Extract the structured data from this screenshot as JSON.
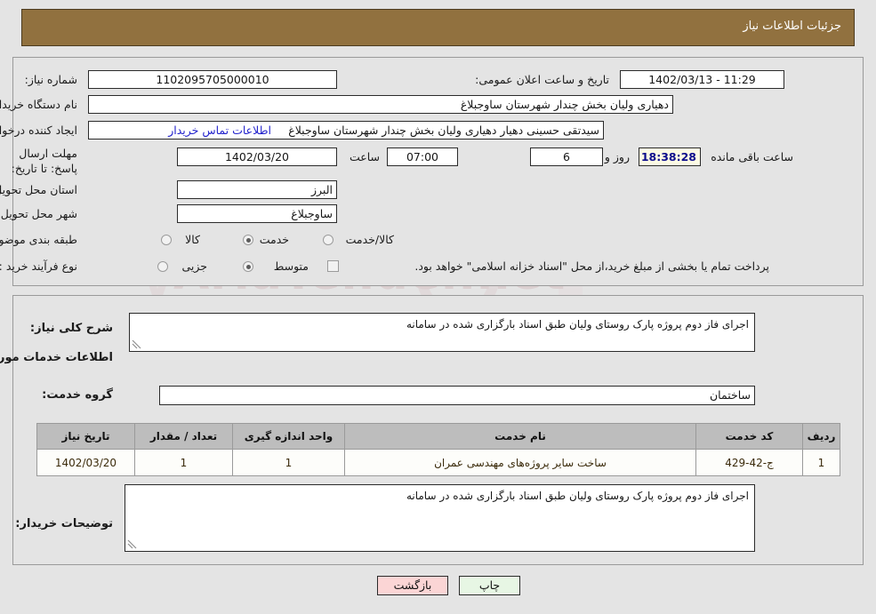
{
  "header": {
    "title": "جزئیات اطلاعات نیاز"
  },
  "watermark": {
    "text": "AriaTender.net"
  },
  "top_panel": {
    "need_number": {
      "label": "شماره نیاز:",
      "value": "1102095705000010"
    },
    "public_announce": {
      "label": "تاریخ و ساعت اعلان عمومی:",
      "value": "11:29 - 1402/03/13"
    },
    "buyer_org": {
      "label": "نام دستگاه خریدار:",
      "value": "دهیاری ولیان بخش چندار شهرستان ساوجبلاغ"
    },
    "requester": {
      "label": "ایجاد کننده درخواست:",
      "value": "سیدتقی حسینی دهیار دهیاری ولیان بخش چندار شهرستان ساوجبلاغ"
    },
    "contact_link": "اطلاعات تماس خریدار",
    "deadline": {
      "label": "مهلت ارسال پاسخ: تا تاریخ:",
      "date": "1402/03/20",
      "hour_label": "ساعت",
      "hour": "07:00",
      "days": "6",
      "days_label": "روز و",
      "timer": "18:38:28",
      "timer_label": "ساعت باقی مانده"
    },
    "province": {
      "label": "استان محل تحویل:",
      "value": "البرز"
    },
    "city": {
      "label": "شهر محل تحویل:",
      "value": "ساوجبلاغ"
    },
    "category": {
      "label": "طبقه بندی موضوعی:",
      "options": [
        "کالا",
        "خدمت",
        "کالا/خدمت"
      ],
      "selected": "خدمت"
    },
    "process_type": {
      "label": "نوع فرآیند خرید :",
      "options": [
        "جزیی",
        "متوسط"
      ],
      "selected": "متوسط",
      "treasury_note": "پرداخت تمام یا بخشی از مبلغ خرید،از محل \"اسناد خزانه اسلامی\" خواهد بود."
    }
  },
  "middle_panel": {
    "general_desc": {
      "label": "شرح کلی نیاز:",
      "value": "اجرای فاز دوم پروژه پارک روستای ولیان طبق اسناد بارگزاری شده در سامانه"
    },
    "services_section_title": "اطلاعات خدمات مورد نیاز",
    "service_group": {
      "label": "گروه خدمت:",
      "value": "ساختمان"
    },
    "table": {
      "columns": [
        "ردیف",
        "کد خدمت",
        "نام خدمت",
        "واحد اندازه گیری",
        "تعداد / مقدار",
        "تاریخ نیاز"
      ],
      "rows": [
        [
          "1",
          "ج-42-429",
          "ساخت سایر پروژه‌های مهندسی عمران",
          "1",
          "1",
          "1402/03/20"
        ]
      ]
    },
    "buyer_notes": {
      "label": "توضیحات خریدار:",
      "value": "اجرای فاز دوم پروژه پارک روستای ولیان طبق اسناد بارگزاری شده در سامانه"
    }
  },
  "footer": {
    "print_label": "چاپ",
    "back_label": "بازگشت"
  },
  "icons": {
    "resize_grip": "◥"
  }
}
